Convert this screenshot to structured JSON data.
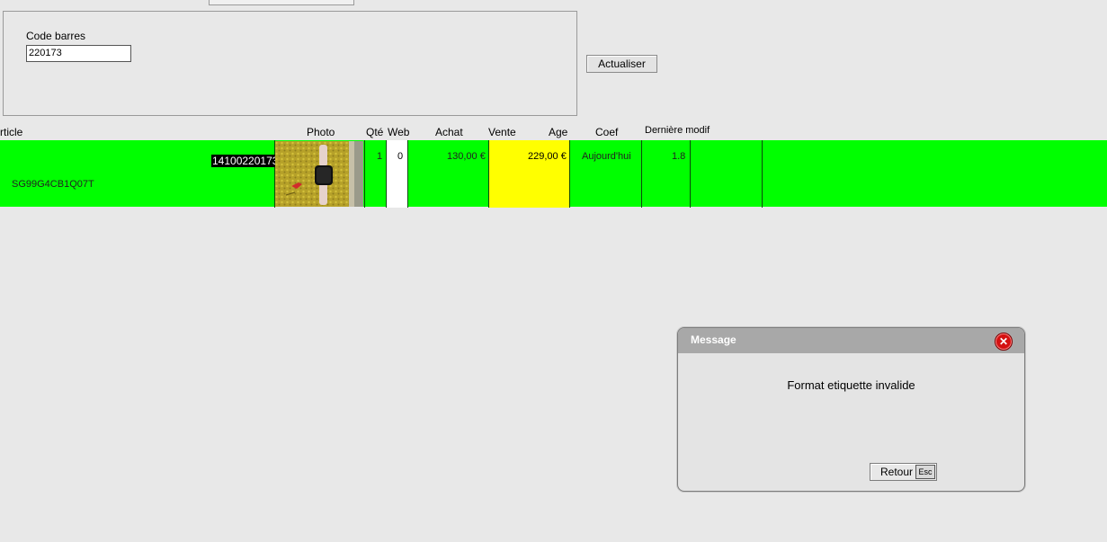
{
  "search": {
    "code_label": "Code barres",
    "code_value": "220173",
    "refresh_label": "Actualiser"
  },
  "columns": {
    "article": "rticle",
    "photo": "Photo",
    "qty": "Qté",
    "web": "Web",
    "achat": "Achat",
    "vente": "Vente",
    "age": "Age",
    "coef": "Coef",
    "derniere_modif": "Dernière modif"
  },
  "row": {
    "barcode": "14100220173",
    "reference": "SG99G4CB1Q07T",
    "qty": "1",
    "web": "0",
    "achat": "130,00 €",
    "vente": "229,00 €",
    "age": "Aujourd'hui",
    "coef": "1.8",
    "photo_icon": "smartwatch-photo",
    "row_color": "#00ff00",
    "vente_color": "#ffff00"
  },
  "dialog": {
    "title": "Message",
    "message": "Format etiquette invalide",
    "button_label": "Retour",
    "button_shortcut": "Esc",
    "close_icon": "close-icon"
  }
}
